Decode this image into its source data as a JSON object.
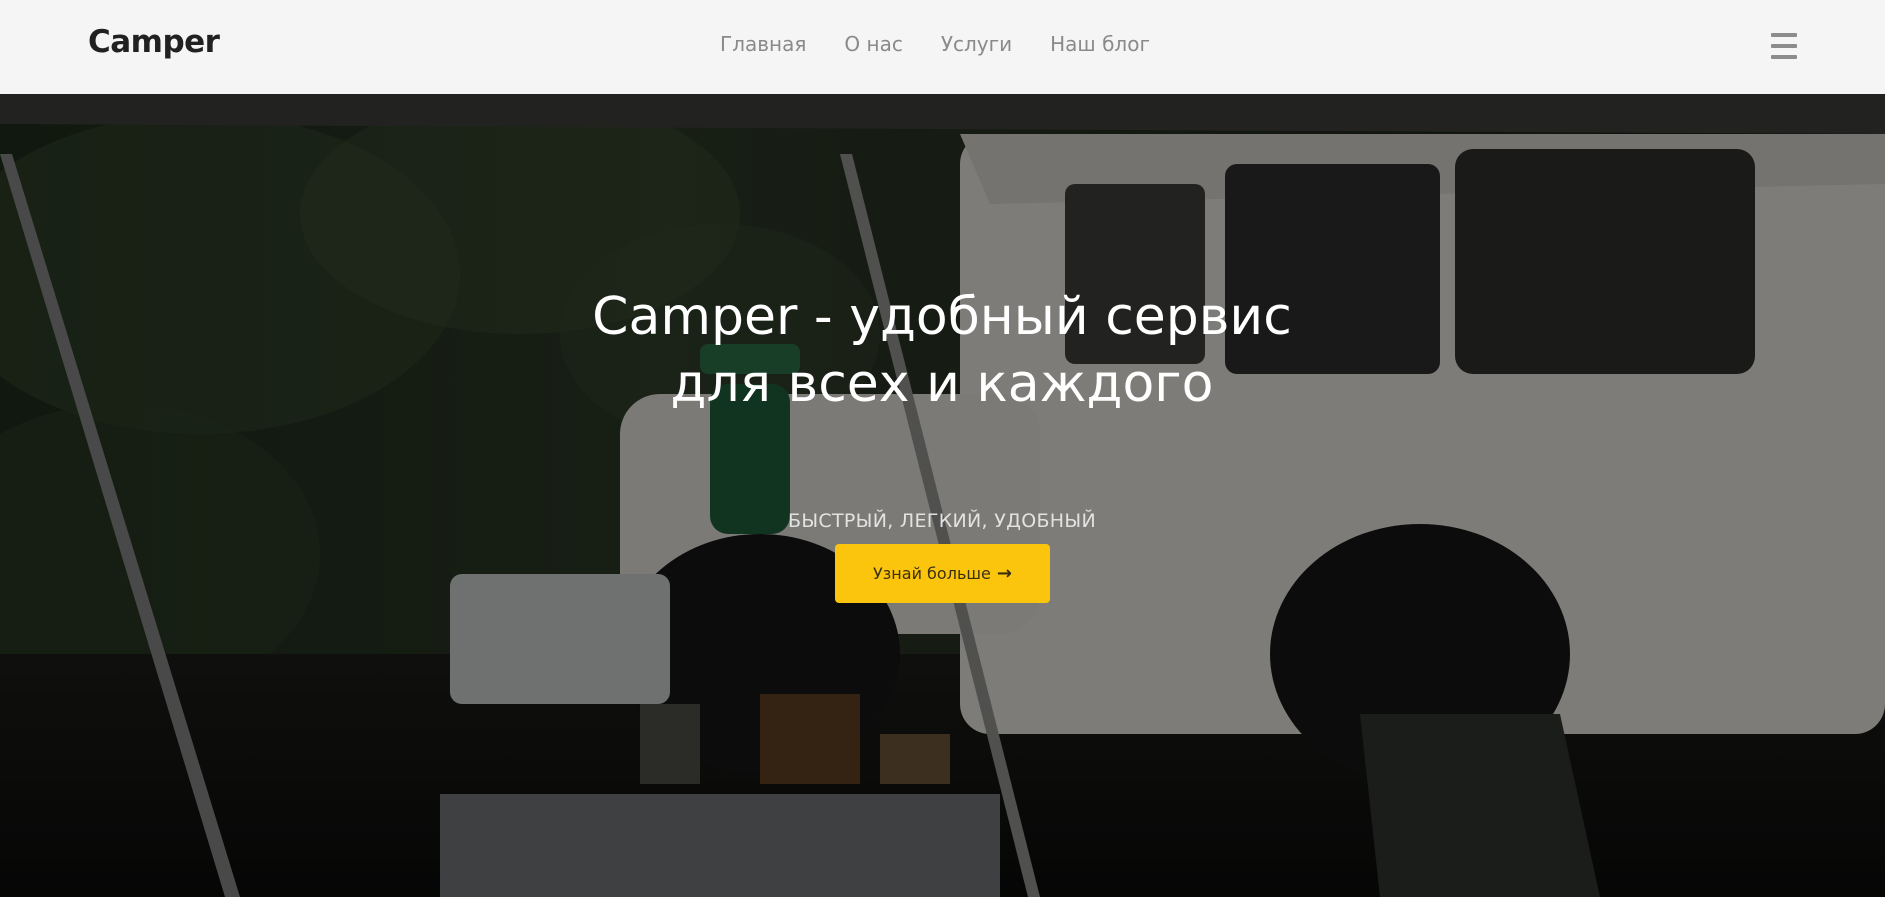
{
  "header": {
    "logo": "Camper",
    "nav": [
      {
        "label": "Главная"
      },
      {
        "label": "О нас"
      },
      {
        "label": "Услуги"
      },
      {
        "label": "Наш блог"
      }
    ]
  },
  "hero": {
    "title": "Camper - удобный сервис для всех и каждого",
    "subtitle": "БЫСТРЫЙ, ЛЕГКИЙ, УДОБНЫЙ",
    "cta_label": "Узнай больше",
    "cta_icon": "arrow-right-icon",
    "cta_icon_glyph": "→"
  },
  "colors": {
    "header_bg": "#f5f5f5",
    "logo": "#212121",
    "nav_text": "#8a8a8a",
    "accent": "#fbc40d",
    "hero_text": "#ffffff"
  }
}
